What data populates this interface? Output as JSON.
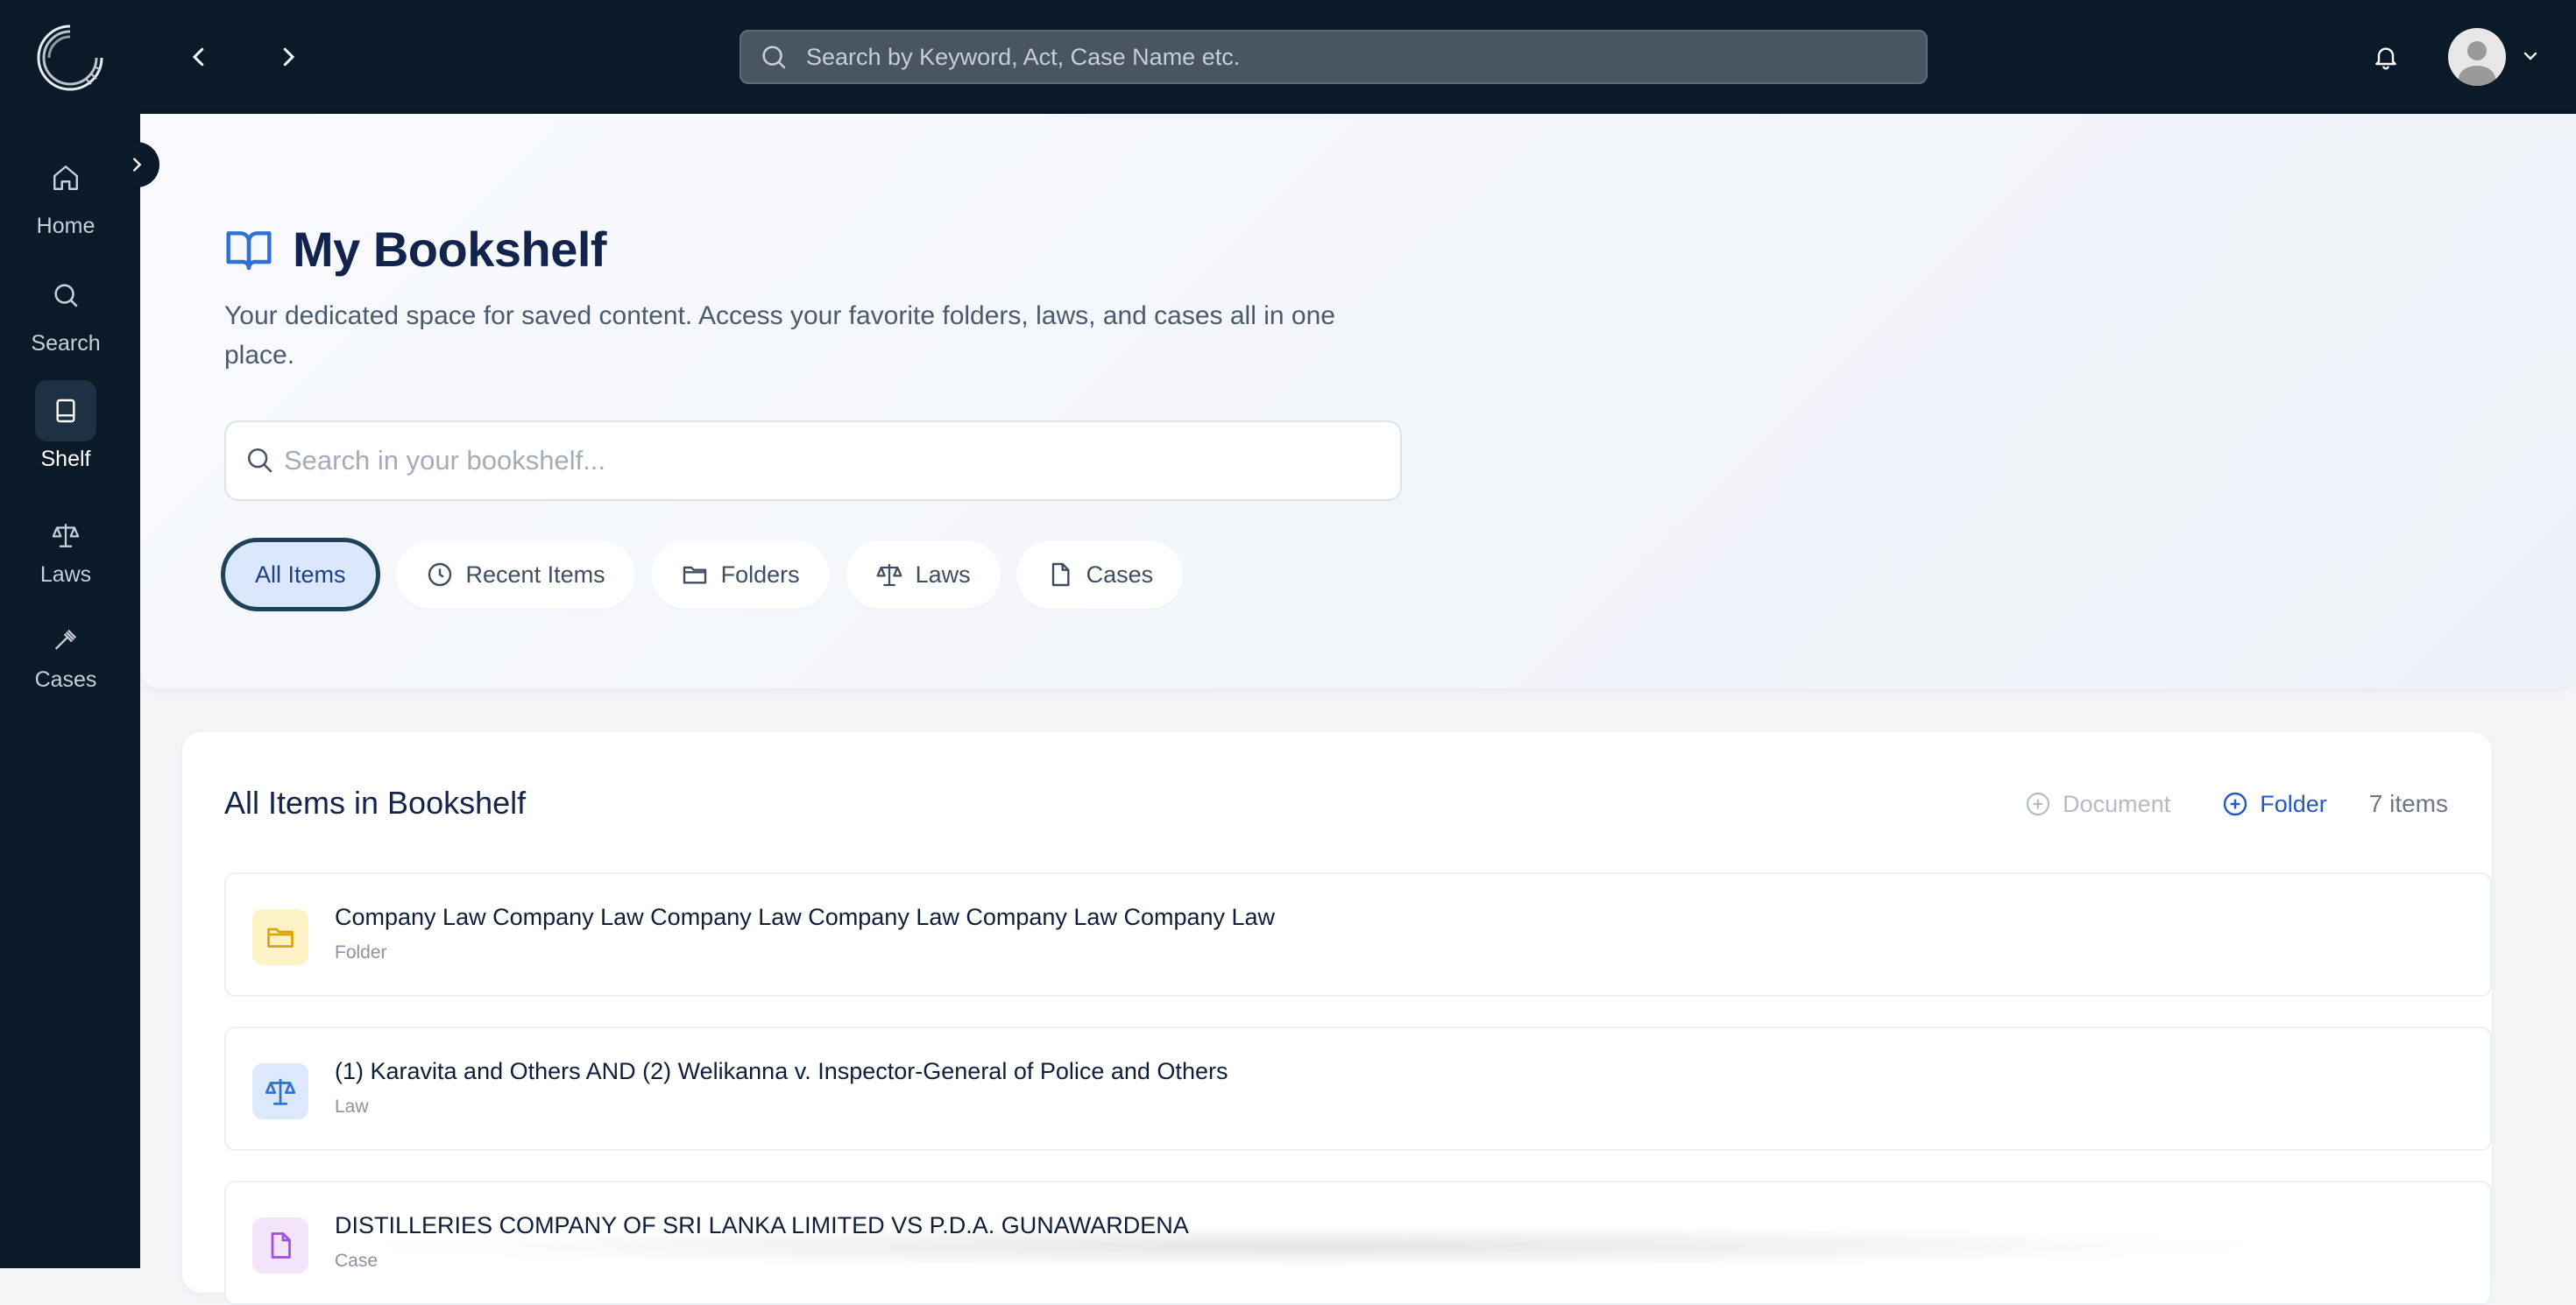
{
  "sidebar": {
    "items": [
      {
        "label": "Home",
        "icon": "home-icon"
      },
      {
        "label": "Search",
        "icon": "search-icon"
      },
      {
        "label": "Shelf",
        "icon": "book-icon",
        "active": true
      },
      {
        "label": "Laws",
        "icon": "scale-icon"
      },
      {
        "label": "Cases",
        "icon": "gavel-icon"
      }
    ]
  },
  "topbar": {
    "search_placeholder": "Search by Keyword, Act, Case Name etc."
  },
  "hero": {
    "title": "My Bookshelf",
    "description": "Your dedicated space for saved content. Access your favorite folders, laws, and cases all in one place.",
    "search_placeholder": "Search in your bookshelf...",
    "filters": [
      {
        "label": "All Items",
        "active": true
      },
      {
        "label": "Recent Items",
        "icon": "clock-icon"
      },
      {
        "label": "Folders",
        "icon": "folder-icon"
      },
      {
        "label": "Laws",
        "icon": "scale-icon"
      },
      {
        "label": "Cases",
        "icon": "file-icon"
      }
    ]
  },
  "list": {
    "title": "All Items in Bookshelf",
    "add_document_label": "Document",
    "add_folder_label": "Folder",
    "count_label": "7 items",
    "items": [
      {
        "title": "Company Law Company Law Company Law Company Law Company Law Company Law",
        "type": "Folder",
        "icon": "folder-icon",
        "color": "#d9a406"
      },
      {
        "title": "(1) Karavita and Others AND (2) Welikanna v. Inspector-General of Police and Others",
        "type": "Law",
        "icon": "scale-icon",
        "color": "#2f6fd6"
      },
      {
        "title": "DISTILLERIES COMPANY OF SRI LANKA LIMITED VS P.D.A. GUNAWARDENA",
        "type": "Case",
        "icon": "file-icon",
        "color": "#a24fd9"
      }
    ]
  },
  "colors": {
    "sidebar_bg": "#0b1a28",
    "accent": "#2458c6",
    "active_chip_bg": "#dbe8fb"
  }
}
